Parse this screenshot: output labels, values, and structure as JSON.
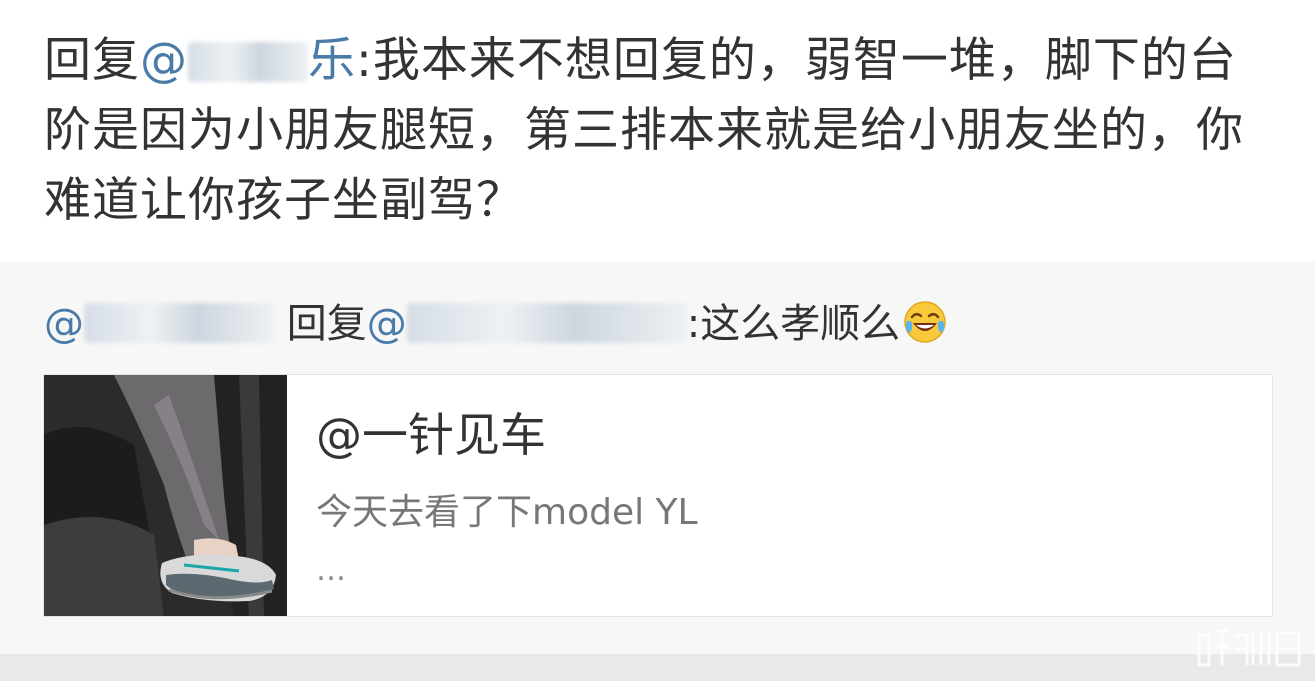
{
  "reply": {
    "prefix": "回复",
    "mention_start": "@",
    "mention_end": "乐",
    "body": ":我本来不想回复的，弱智一堆，脚下的台阶是因为小朋友腿短，第三排本来就是给小朋友坐的，你难道让你孩子坐副驾？"
  },
  "quote": {
    "mention_start": "@",
    "reply_word": "回复",
    "mention2_start": "@",
    "body": ":这么孝顺么",
    "emoji": "laughing-crying-emoji"
  },
  "card": {
    "title": "@一针见车",
    "description": "今天去看了下model YL",
    "more": "…"
  },
  "colors": {
    "mention": "#4a7ba8",
    "text": "#333333",
    "background": "#ffffff",
    "quote_background": "#f7f7f7"
  }
}
